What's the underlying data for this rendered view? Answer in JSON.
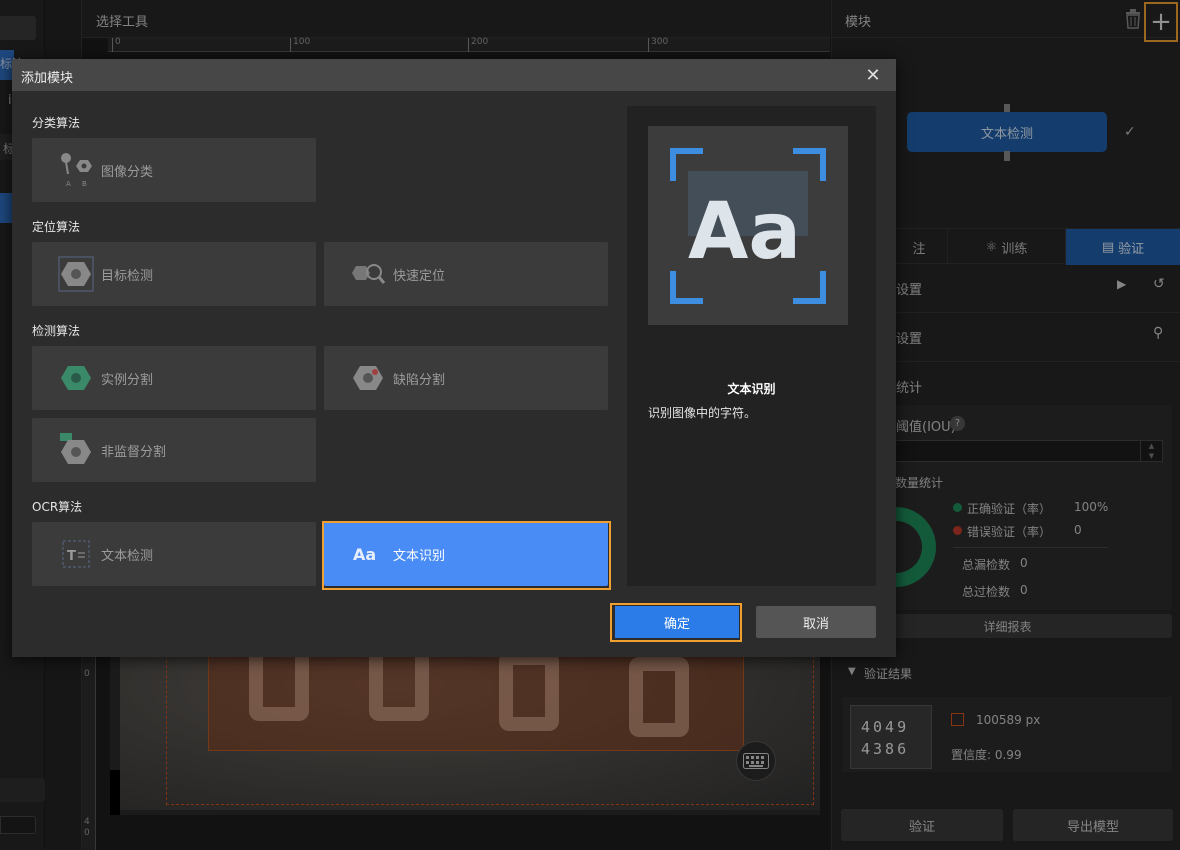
{
  "colors": {
    "accent": "#2b7be8",
    "highlight": "#f0a030",
    "node": "#1f5ea8",
    "correct": "#1e8a5a",
    "error": "#c0392b"
  },
  "left_fragments": {
    "blue_text": "标注",
    "letter": "i",
    "label": "标"
  },
  "canvas": {
    "title": "选择工具",
    "ruler_ticks": [
      "0",
      "100",
      "200",
      "300"
    ],
    "vruler_top": "0",
    "vruler_bottom": "4\n0",
    "keyboard_icon": "keyboard-icon"
  },
  "right": {
    "title": "模块",
    "node_label": "文本检测",
    "tabs": [
      {
        "label": "注"
      },
      {
        "label": "训练"
      },
      {
        "label": "验证"
      }
    ],
    "rows": [
      {
        "label": "设置"
      },
      {
        "label": "设置"
      },
      {
        "label": "统计"
      }
    ],
    "iou_label": "阈值(IOU)",
    "count_title": "数量统计",
    "legend": [
      {
        "label": "正确验证（率）",
        "value": "100%"
      },
      {
        "label": "错误验证（率）",
        "value": "0"
      }
    ],
    "missed": {
      "label": "总漏检数",
      "value": "0"
    },
    "over": {
      "label": "总过检数",
      "value": "0"
    },
    "detail_btn": "详细报表",
    "results_title": "验证结果",
    "result": {
      "thumb_top": "4049",
      "thumb_bottom": "4386",
      "size": "100589 px",
      "confidence": "置信度: 0.99"
    },
    "validate_btn": "验证",
    "export_btn": "导出模型"
  },
  "dialog": {
    "title": "添加模块",
    "categories": [
      {
        "title": "分类算法",
        "items": [
          {
            "label": "图像分类",
            "icon": "pins-icon"
          }
        ]
      },
      {
        "title": "定位算法",
        "items": [
          {
            "label": "目标检测",
            "icon": "nut-icon"
          },
          {
            "label": "快速定位",
            "icon": "search-nut-icon"
          }
        ]
      },
      {
        "title": "检测算法",
        "items": [
          {
            "label": "实例分割",
            "icon": "green-nut-icon"
          },
          {
            "label": "缺陷分割",
            "icon": "defect-nut-icon"
          },
          {
            "label": "非监督分割",
            "icon": "unsupervised-nut-icon"
          }
        ]
      },
      {
        "title": "OCR算法",
        "items": [
          {
            "label": "文本检测",
            "icon": "text-detect-icon"
          },
          {
            "label": "文本识别",
            "icon": "text-recognize-icon"
          }
        ]
      }
    ],
    "preview": {
      "glyph": "Aa",
      "name": "文本识别",
      "desc": "识别图像中的字符。"
    },
    "ok": "确定",
    "cancel": "取消"
  }
}
